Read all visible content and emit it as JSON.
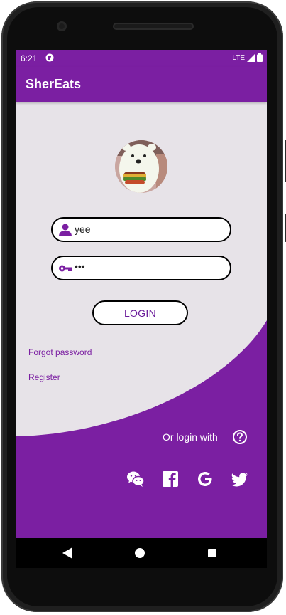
{
  "status_bar": {
    "time": "6:21",
    "network": "LTE"
  },
  "app_bar": {
    "title": "SherEats"
  },
  "username_field": {
    "value": "yee"
  },
  "password_field": {
    "value": "•••"
  },
  "login_button": {
    "label": "LOGIN"
  },
  "links": {
    "forgot_password": "Forgot password",
    "register": "Register"
  },
  "social": {
    "or_login_with": "Or login with",
    "providers": [
      "wechat-icon",
      "facebook-icon",
      "google-icon",
      "twitter-icon"
    ]
  },
  "colors": {
    "primary": "#7b1fa2",
    "background": "#e7e3e8",
    "text_on_primary": "#ffffff"
  }
}
